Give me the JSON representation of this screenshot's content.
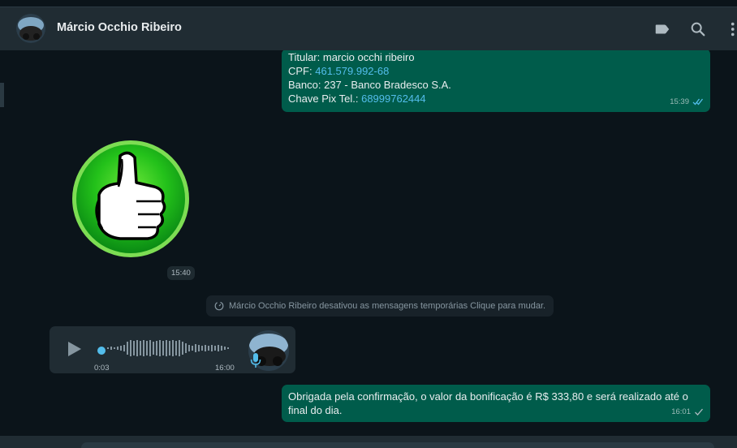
{
  "header": {
    "contact_name": "Márcio Occhio Ribeiro",
    "icons": [
      "label-icon",
      "search-icon",
      "menu-icon"
    ]
  },
  "messages": {
    "bank_info": {
      "titular": "Titular: marcio occhi ribeiro",
      "cpf_label": "CPF: ",
      "cpf_value": "461.579.992-68",
      "banco": "Banco: 237 - Banco Bradesco S.A.",
      "pix_label": "Chave Pix Tel.: ",
      "pix_value": "68999762444",
      "time": "15:39",
      "status": "read"
    },
    "sticker": {
      "time": "15:40",
      "icon": "thumbs-up-icon"
    },
    "system_notice": {
      "text": "Márcio Occhio Ribeiro desativou as mensagens temporárias Clique para mudar."
    },
    "audio": {
      "elapsed": "0:03",
      "time": "16:00",
      "progress": 0
    },
    "confirmation": {
      "text_line1": "Obrigada pela confirmação, o valor da bonificação é R$ 333,80 e será realizado até o",
      "text_line2": "final do dia.",
      "time": "16:01",
      "status": "sent"
    }
  },
  "colors": {
    "outgoing": "#005c4b",
    "incoming": "#202c33",
    "link": "#53bdeb",
    "background": "#0b141a"
  }
}
